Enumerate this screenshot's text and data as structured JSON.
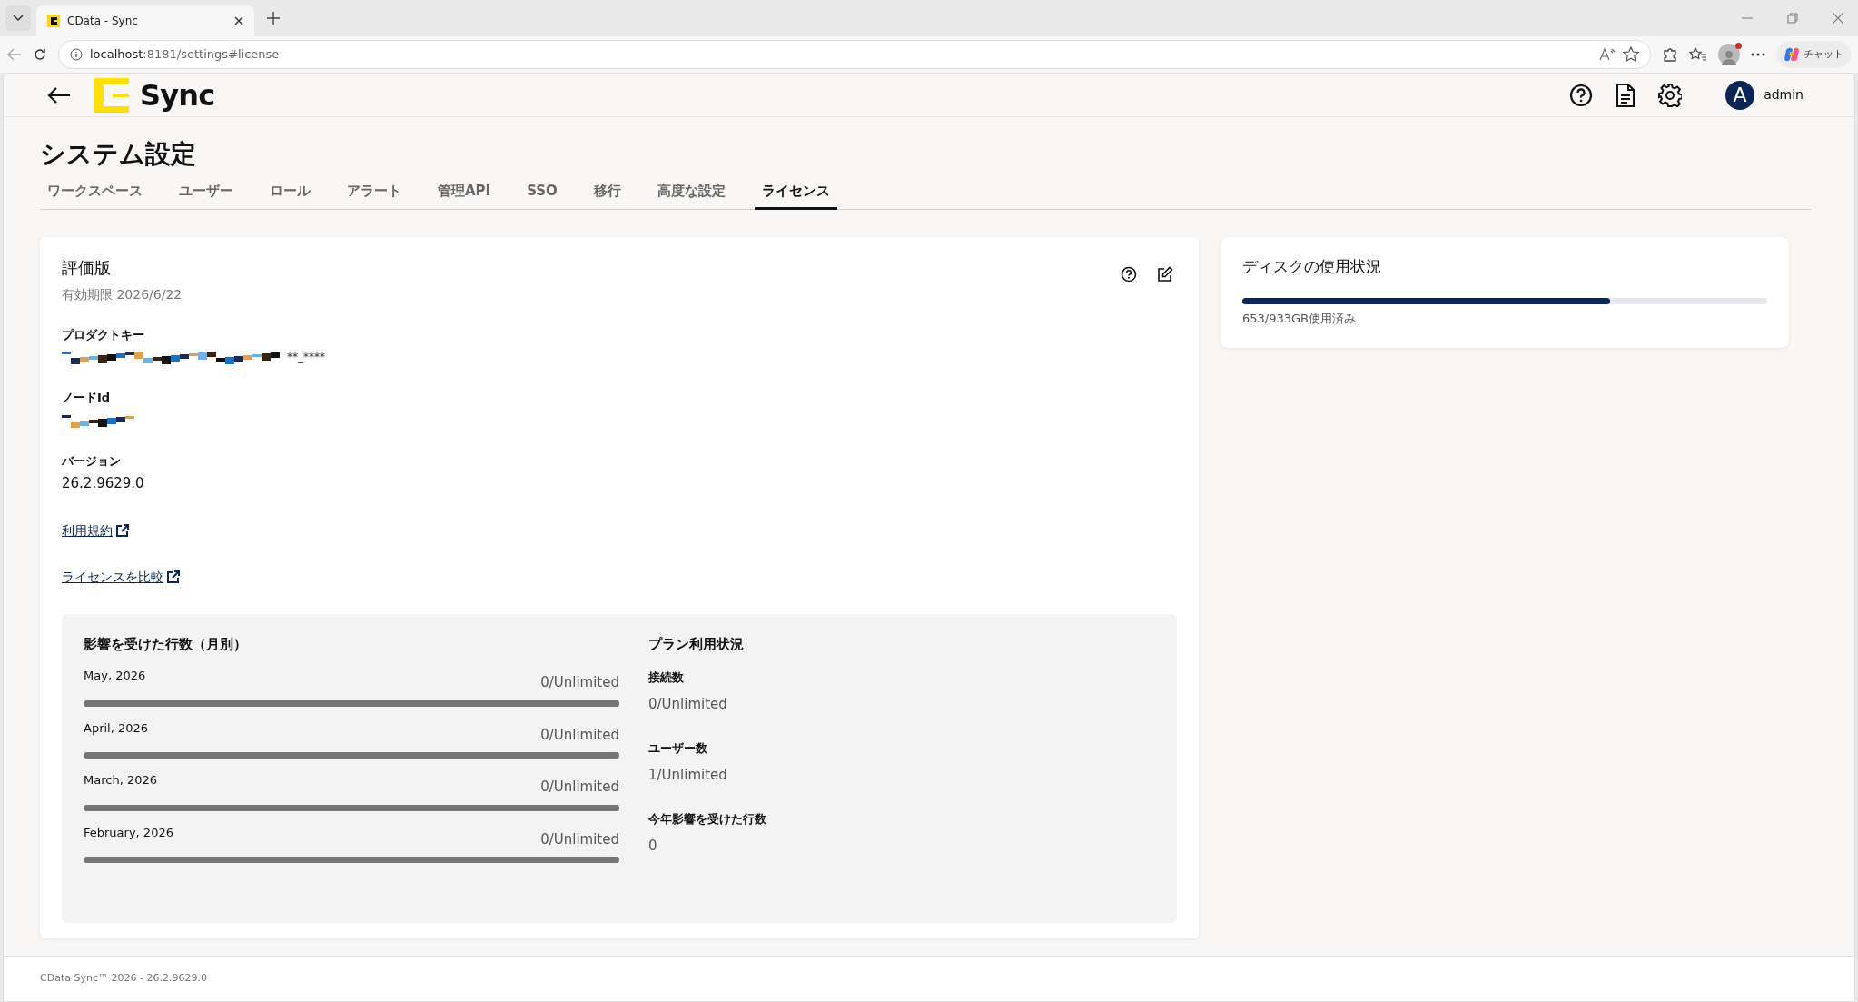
{
  "browser": {
    "tab_title": "CData - Sync",
    "url_host": "localhost",
    "url_rest": ":8181/settings#license",
    "chat_label": "チャット"
  },
  "header": {
    "app_name": "Sync",
    "user_initial": "A",
    "user_name": "admin"
  },
  "page_title": "システム設定",
  "tabs": [
    {
      "label": "ワークスペース",
      "selected": false
    },
    {
      "label": "ユーザー",
      "selected": false
    },
    {
      "label": "ロール",
      "selected": false
    },
    {
      "label": "アラート",
      "selected": false
    },
    {
      "label": "管理API",
      "selected": false
    },
    {
      "label": "SSO",
      "selected": false
    },
    {
      "label": "移行",
      "selected": false
    },
    {
      "label": "高度な設定",
      "selected": false
    },
    {
      "label": "ライセンス",
      "selected": true
    }
  ],
  "license": {
    "title": "評価版",
    "expiry": "有効期限 2026/6/22",
    "fields": [
      {
        "label": "プロダクトキー",
        "redacted": true,
        "value": "**_****"
      },
      {
        "label": "ノードId",
        "redacted": true
      },
      {
        "label": "バージョン",
        "redacted": false,
        "value": "26.2.9629.0"
      }
    ],
    "links": [
      "利用規約",
      "ライセンスを比較"
    ]
  },
  "monthly": {
    "title": "影響を受けた行数（月別）",
    "rows": [
      {
        "month": "May, 2026",
        "usage": "0/Unlimited"
      },
      {
        "month": "April, 2026",
        "usage": "0/Unlimited"
      },
      {
        "month": "March, 2026",
        "usage": "0/Unlimited"
      },
      {
        "month": "February, 2026",
        "usage": "0/Unlimited"
      }
    ]
  },
  "plan": {
    "title": "プラン利用状況",
    "items": [
      {
        "label": "接続数",
        "value": "0/Unlimited"
      },
      {
        "label": "ユーザー数",
        "value": "1/Unlimited"
      },
      {
        "label": "今年影響を受けた行数",
        "value": "0"
      }
    ]
  },
  "disk": {
    "title": "ディスクの使用状況",
    "level": 0.7,
    "caption": "653/933GB使用済み"
  },
  "footer": "CData Sync™ 2026 - 26.2.9629.0"
}
